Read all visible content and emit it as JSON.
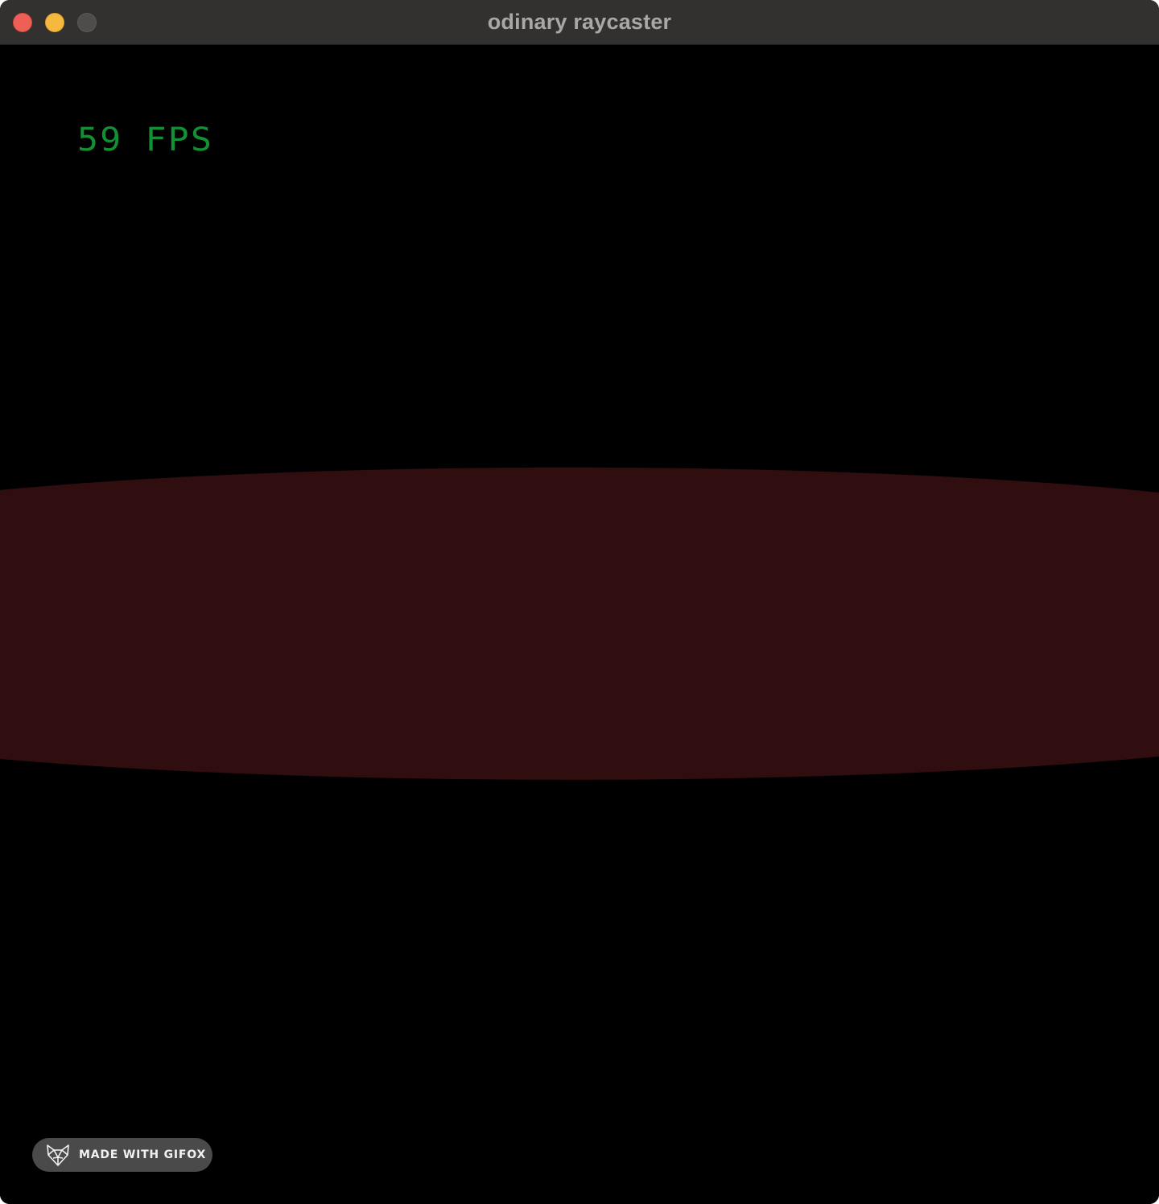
{
  "window": {
    "title": "odinary raycaster",
    "controls": {
      "close_color": "#ee5f56",
      "minimize_color": "#f5b93e",
      "zoom_color": "#4e4d4c"
    }
  },
  "game": {
    "fps_text": "59 FPS",
    "fps_color": "#129033",
    "background_color": "#000000",
    "wall_color": "#300e0f"
  },
  "watermark": {
    "text": "MADE WITH GIFOX",
    "icon": "fox-icon"
  }
}
